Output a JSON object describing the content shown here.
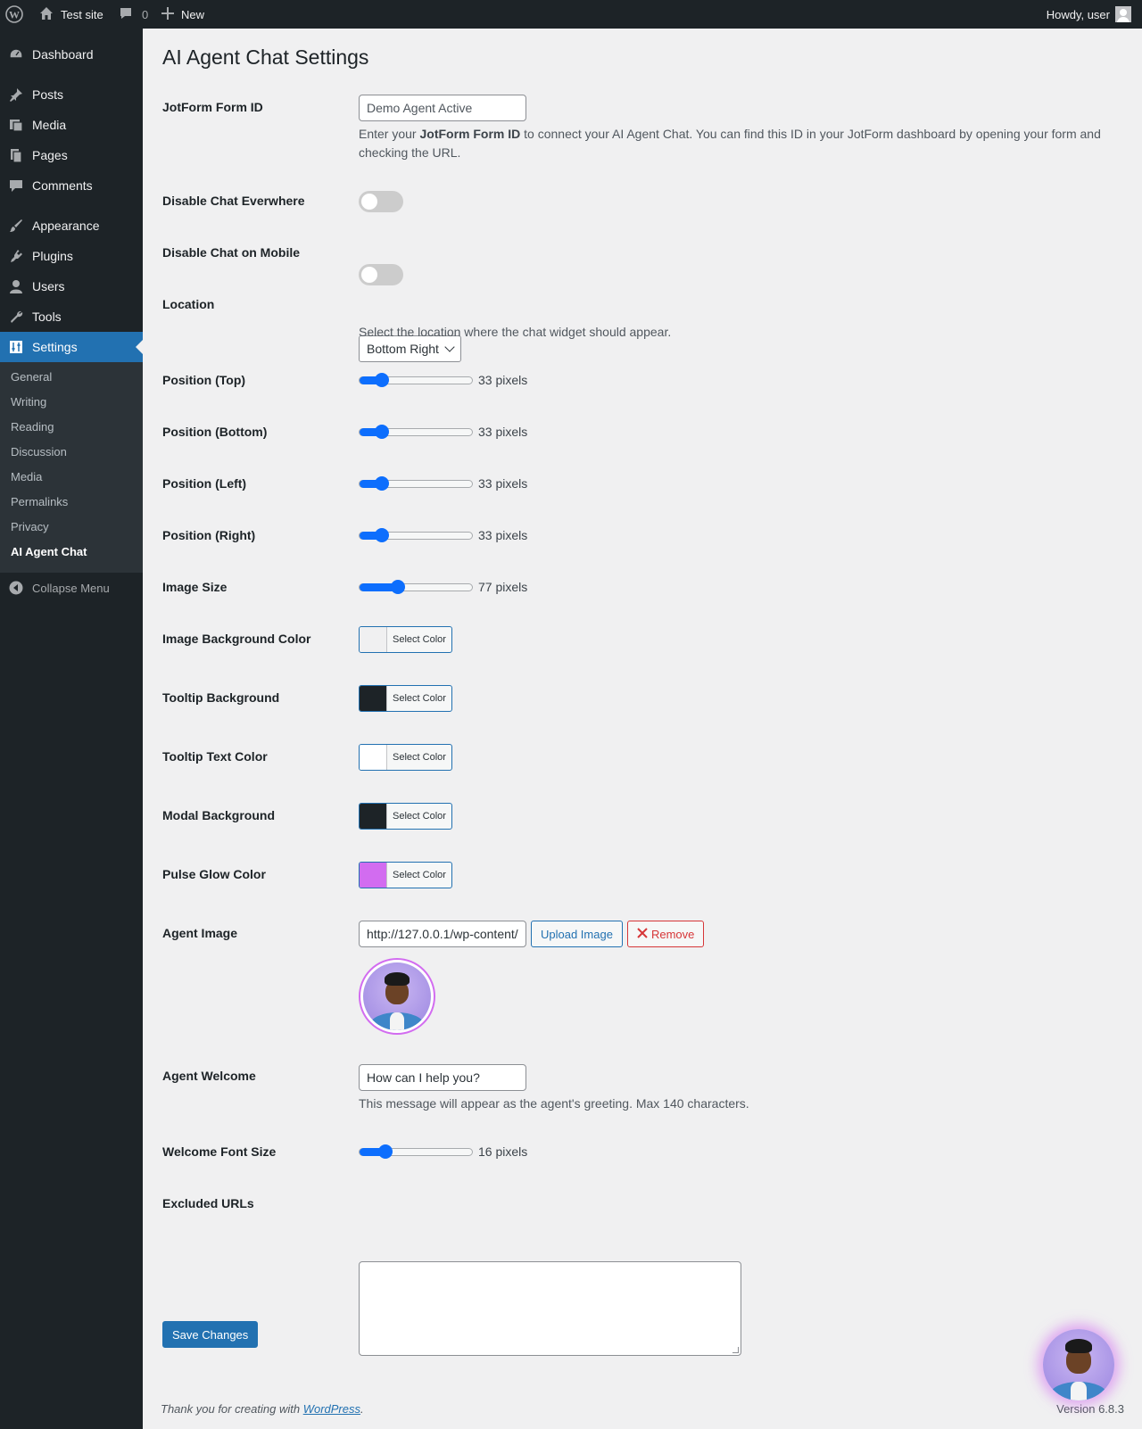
{
  "adminbar": {
    "site_name": "Test site",
    "comments_count": "0",
    "new_label": "New",
    "howdy": "Howdy, user"
  },
  "sidebar": {
    "items": [
      {
        "label": "Dashboard",
        "icon": "dashboard-icon"
      },
      {
        "label": "Posts",
        "icon": "pin-icon"
      },
      {
        "label": "Media",
        "icon": "media-icon"
      },
      {
        "label": "Pages",
        "icon": "pages-icon"
      },
      {
        "label": "Comments",
        "icon": "comment-icon"
      },
      {
        "label": "Appearance",
        "icon": "brush-icon"
      },
      {
        "label": "Plugins",
        "icon": "plugin-icon"
      },
      {
        "label": "Users",
        "icon": "user-icon"
      },
      {
        "label": "Tools",
        "icon": "wrench-icon"
      },
      {
        "label": "Settings",
        "icon": "settings-icon"
      }
    ],
    "submenu": [
      "General",
      "Writing",
      "Reading",
      "Discussion",
      "Media",
      "Permalinks",
      "Privacy",
      "AI Agent Chat"
    ],
    "collapse_label": "Collapse Menu"
  },
  "page": {
    "title": "AI Agent Chat Settings",
    "form_id": {
      "label": "JotForm Form ID",
      "value": "Demo Agent Active",
      "desc_pre": "Enter your ",
      "desc_bold": "JotForm Form ID",
      "desc_post": " to connect your AI Agent Chat. You can find this ID in your JotForm dashboard by opening your form and checking the URL."
    },
    "disable_everywhere": {
      "label": "Disable Chat Everwhere",
      "on": false
    },
    "disable_mobile": {
      "label": "Disable Chat on Mobile",
      "on": false
    },
    "location": {
      "label": "Location",
      "value": "Bottom Right",
      "desc": "Select the location where the chat widget should appear."
    },
    "pos_top": {
      "label": "Position (Top)",
      "value": "33 pixels",
      "fraction": 0.2
    },
    "pos_bottom": {
      "label": "Position (Bottom)",
      "value": "33 pixels",
      "fraction": 0.2
    },
    "pos_left": {
      "label": "Position (Left)",
      "value": "33 pixels",
      "fraction": 0.2
    },
    "pos_right": {
      "label": "Position (Right)",
      "value": "33 pixels",
      "fraction": 0.2
    },
    "image_size": {
      "label": "Image Size",
      "value": "77 pixels",
      "fraction": 0.34
    },
    "select_color_label": "Select Color",
    "image_bg": {
      "label": "Image Background Color",
      "color": "#f0f0f1"
    },
    "tooltip_bg": {
      "label": "Tooltip Background",
      "color": "#1d2327"
    },
    "tooltip_text": {
      "label": "Tooltip Text Color",
      "color": "#ffffff"
    },
    "modal_bg": {
      "label": "Modal Background",
      "color": "#1d2327"
    },
    "pulse_glow": {
      "label": "Pulse Glow Color",
      "color": "#d26cf0"
    },
    "agent_image": {
      "label": "Agent Image",
      "value": "http://127.0.0.1/wp-content/",
      "upload_label": "Upload Image",
      "remove_label": "Remove"
    },
    "agent_welcome": {
      "label": "Agent Welcome",
      "value": "How can I help you?",
      "desc": "This message will appear as the agent's greeting. Max 140 characters."
    },
    "welcome_font": {
      "label": "Welcome Font Size",
      "value": "16 pixels",
      "fraction": 0.23
    },
    "excluded_urls": {
      "label": "Excluded URLs",
      "value": ""
    },
    "save_label": "Save Changes"
  },
  "footer": {
    "thanks_pre": "Thank you for creating with ",
    "thanks_link": "WordPress",
    "thanks_post": ".",
    "version": "Version 6.8.3"
  }
}
